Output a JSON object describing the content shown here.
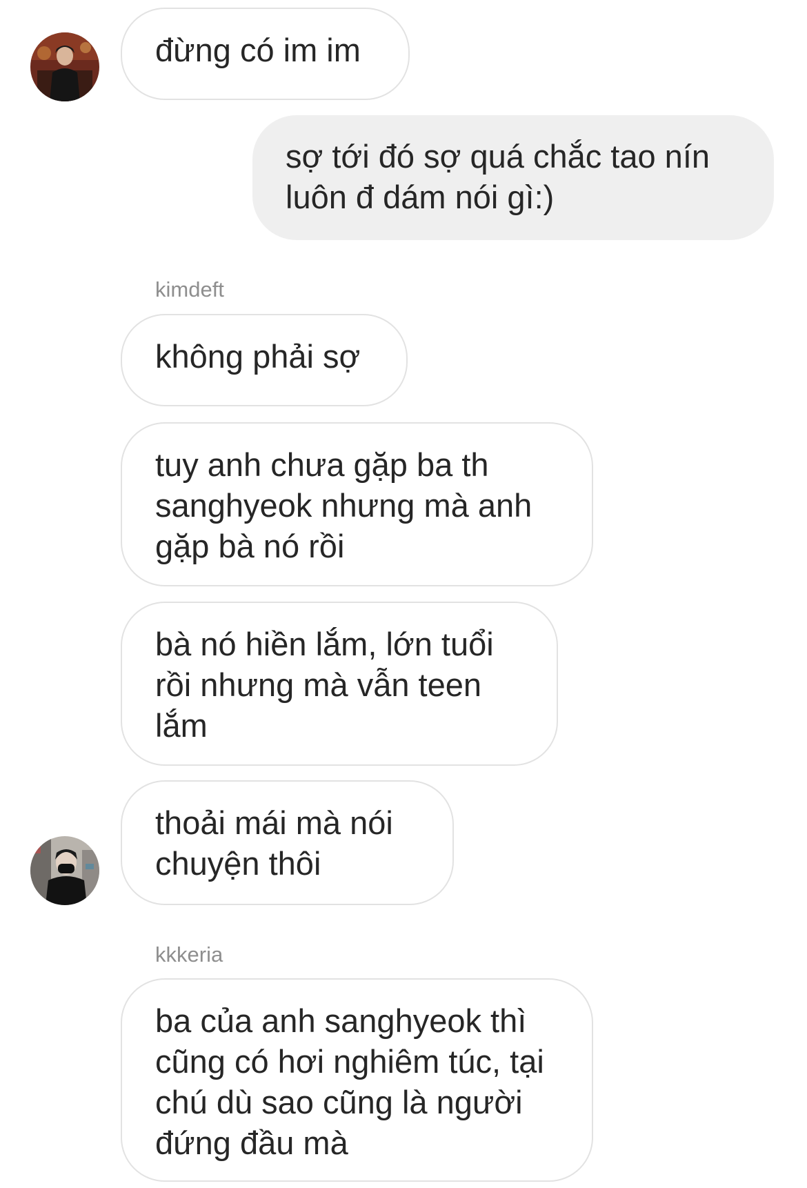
{
  "messages": [
    {
      "text": "đừng có im im"
    },
    {
      "text": "sợ tới đó sợ quá chắc tao nín luôn đ dám nói gì:)"
    },
    {
      "text": "không phải sợ"
    },
    {
      "text": "tuy anh chưa gặp ba th sanghyeok nhưng mà anh gặp bà nó rồi"
    },
    {
      "text": "bà nó hiền lắm, lớn tuổi rồi nhưng mà vẫn teen lắm"
    },
    {
      "text": "thoải mái mà nói chuyện thôi"
    },
    {
      "text": "ba của anh sanghyeok thì cũng có hơi nghiêm túc, tại chú dù sao cũng là người đứng đầu mà"
    }
  ],
  "senders": {
    "first": "kimdeft",
    "second": "kkkeria"
  },
  "colors": {
    "outgoing_bubble": "#efefef",
    "incoming_border": "#e2e2e2",
    "sender_name": "#8e8e8e",
    "text": "#262626"
  }
}
